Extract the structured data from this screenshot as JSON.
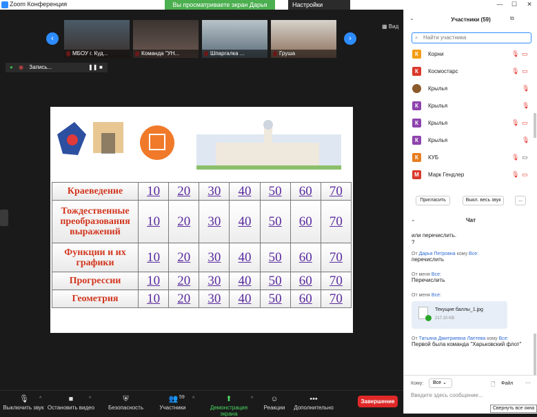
{
  "window": {
    "title": "Zoom Конференция",
    "share_banner": "Вы просматриваете экран Дарья Петровна",
    "view_options": "Настройки просмотра"
  },
  "thumbnails": [
    {
      "label": "МБОУ г. Куд..."
    },
    {
      "label": "Команда \"УН..."
    },
    {
      "label": "Шпаргалка ..."
    },
    {
      "label": "Груша"
    }
  ],
  "view_label": "Вид",
  "recording": {
    "label": "Запись..."
  },
  "slide": {
    "points": [
      "10",
      "20",
      "30",
      "40",
      "50",
      "60",
      "70"
    ],
    "rows": [
      {
        "category": "Краеведение"
      },
      {
        "category": "Тождественные преобразования выражений"
      },
      {
        "category": "Функции и их графики"
      },
      {
        "category": "Прогрессии"
      },
      {
        "category": "Геометрия"
      }
    ]
  },
  "toolbar": {
    "mute": "Выключить звук",
    "video": "Остановить видео",
    "security": "Безопасность",
    "participants": "Участники",
    "participants_count": "59",
    "share": "Демонстрация экрана",
    "reactions": "Реакции",
    "more": "Дополнительно",
    "end": "Завершение"
  },
  "participants_panel": {
    "title": "Участники (59)",
    "search_placeholder": "Найти участника",
    "list": [
      {
        "initial": "К",
        "name": "Корни",
        "color": "#f39c12"
      },
      {
        "initial": "К",
        "name": "Космостарс",
        "color": "#d9382b"
      },
      {
        "initial": "",
        "name": "Крылья",
        "color": "#8a5a2b"
      },
      {
        "initial": "К",
        "name": "Крылья",
        "color": "#8e44ad"
      },
      {
        "initial": "К",
        "name": "Крылья",
        "color": "#8e44ad"
      },
      {
        "initial": "К",
        "name": "Крылья",
        "color": "#8e44ad"
      },
      {
        "initial": "К",
        "name": "КУБ",
        "color": "#e67e22"
      },
      {
        "initial": "М",
        "name": "Марк Гендлер",
        "color": "#d9382b"
      }
    ],
    "invite": "Пригласить",
    "mute_all": "Выкл. весь звук",
    "more": "..."
  },
  "chat": {
    "title": "Чат",
    "messages": [
      {
        "text": "или перечислить."
      },
      {
        "text": "?"
      },
      {
        "from": "От",
        "sender": "Дарья Петровна",
        "to": "кому",
        "recipient": "Все:",
        "text": "перечислить"
      },
      {
        "from": "От меня",
        "recipient": "Все:",
        "text": "Перечислить"
      },
      {
        "from": "От меня",
        "recipient": "Все:"
      },
      {
        "from": "От",
        "sender": "Татьяна Дмитриевна Лаптева",
        "to": "кому",
        "recipient": "Все:",
        "text": "Первой была команда \"Харьковский флот\""
      }
    ],
    "file_name": "Текущие баллы_1.jpg",
    "file_size": "217.10 KB",
    "to_label": "Кому:",
    "to_value": "Все",
    "file_button": "Файл",
    "input_placeholder": "Введите здесь сообщение...",
    "tooltip": "Свернуть все окна"
  }
}
